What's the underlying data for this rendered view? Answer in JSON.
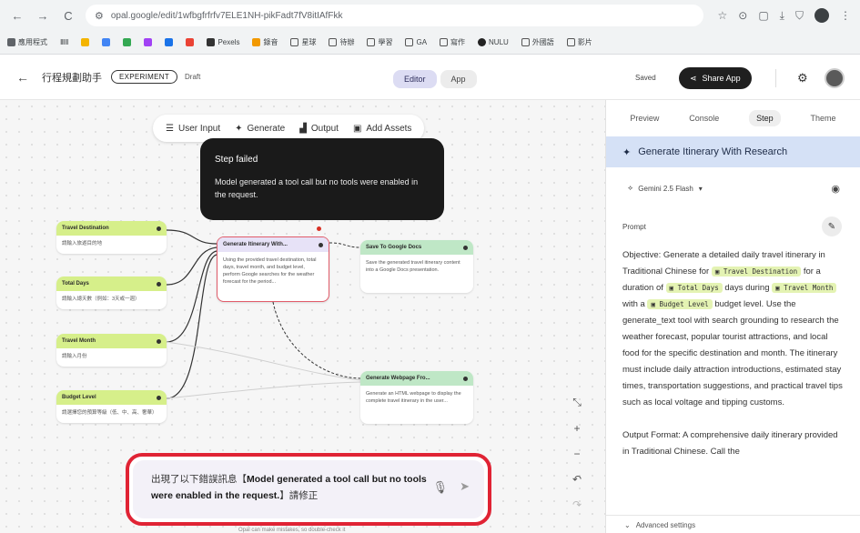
{
  "browser": {
    "url": "opal.google/edit/1wfbgfrfrfv7ELE1NH-pikFadt7fV8itIAfFkk",
    "nav": [
      "←",
      "→",
      "C"
    ],
    "bookmarks": [
      "應用程式",
      "ⅢⅡ",
      "",
      "",
      "",
      "",
      "",
      "",
      "",
      "Pexels",
      "錄音",
      "星球",
      "待辦",
      "學習",
      "GA",
      "寫作",
      "NULU",
      "外國語",
      "影片"
    ]
  },
  "header": {
    "app_title": "行程規劃助手",
    "badge": "EXPERIMENT",
    "draft": "Draft",
    "modes": [
      "Editor",
      "App"
    ],
    "saved": "Saved",
    "share": "Share App"
  },
  "toolbar": {
    "items": [
      "User Input",
      "Generate",
      "Output",
      "Add Assets"
    ]
  },
  "error_tooltip": {
    "title": "Step failed",
    "message": "Model generated a tool call but no tools were enabled in the request."
  },
  "nodes": {
    "inputs": [
      {
        "title": "Travel Destination",
        "body": "請輸入旅遊目的地"
      },
      {
        "title": "Total Days",
        "body": "請輸入總天數（例如：3天或一週）"
      },
      {
        "title": "Travel Month",
        "body": "請輸入月份"
      },
      {
        "title": "Budget Level",
        "body": "請選擇您的預算等級（低、中、高、奢華）"
      }
    ],
    "generate": {
      "title": "Generate Itinerary With...",
      "body": "Using the provided travel destination, total days, travel month, and budget level, perform Google searches for the weather forecast for the period..."
    },
    "outputs": [
      {
        "title": "Save To Google Docs",
        "body": "Save the generated travel itinerary content into a Google Docs presentation."
      },
      {
        "title": "Generate Webpage Fro...",
        "body": "Generate an HTML webpage to display the complete travel itinerary in the user..."
      }
    ]
  },
  "zoom_controls": [
    "⤡",
    "+",
    "−",
    "↶",
    "↷"
  ],
  "chat": {
    "prefix": "出現了以下錯誤訊息【",
    "bold": "Model generated a tool call but no tools were enabled in the request.",
    "suffix": "】請修正"
  },
  "footnote": "Opal can make mistakes, so double-check it",
  "panel": {
    "tabs": [
      "Preview",
      "Console",
      "Step",
      "Theme"
    ],
    "active_tab": "Step",
    "step_title": "Generate Itinerary With Research",
    "model": "Gemini 2.5 Flash",
    "prompt_label": "Prompt",
    "prompt": {
      "p1": "Objective: Generate a detailed daily travel itinerary in Traditional Chinese for",
      "chip_destination": "Travel Destination",
      "p2": "for a duration of",
      "chip_days": "Total Days",
      "p3": "days during",
      "chip_month": "Travel Month",
      "p4": "with a",
      "chip_budget": "Budget Level",
      "p5": "budget level. Use the generate_text tool with search grounding to research the weather forecast, popular tourist attractions, and local food for the specific destination and month. The itinerary must include daily attraction introductions, estimated stay times, transportation suggestions, and practical travel tips such as local voltage and tipping customs.",
      "p6": "Output Format: A comprehensive daily itinerary provided in Traditional Chinese. Call the"
    },
    "advanced": "Advanced settings"
  },
  "colors": {
    "error_border": "#e02334",
    "input_node": "#d6ef8a",
    "output_node": "#bfe7c6",
    "step_title_bg": "#d5e1f6"
  }
}
